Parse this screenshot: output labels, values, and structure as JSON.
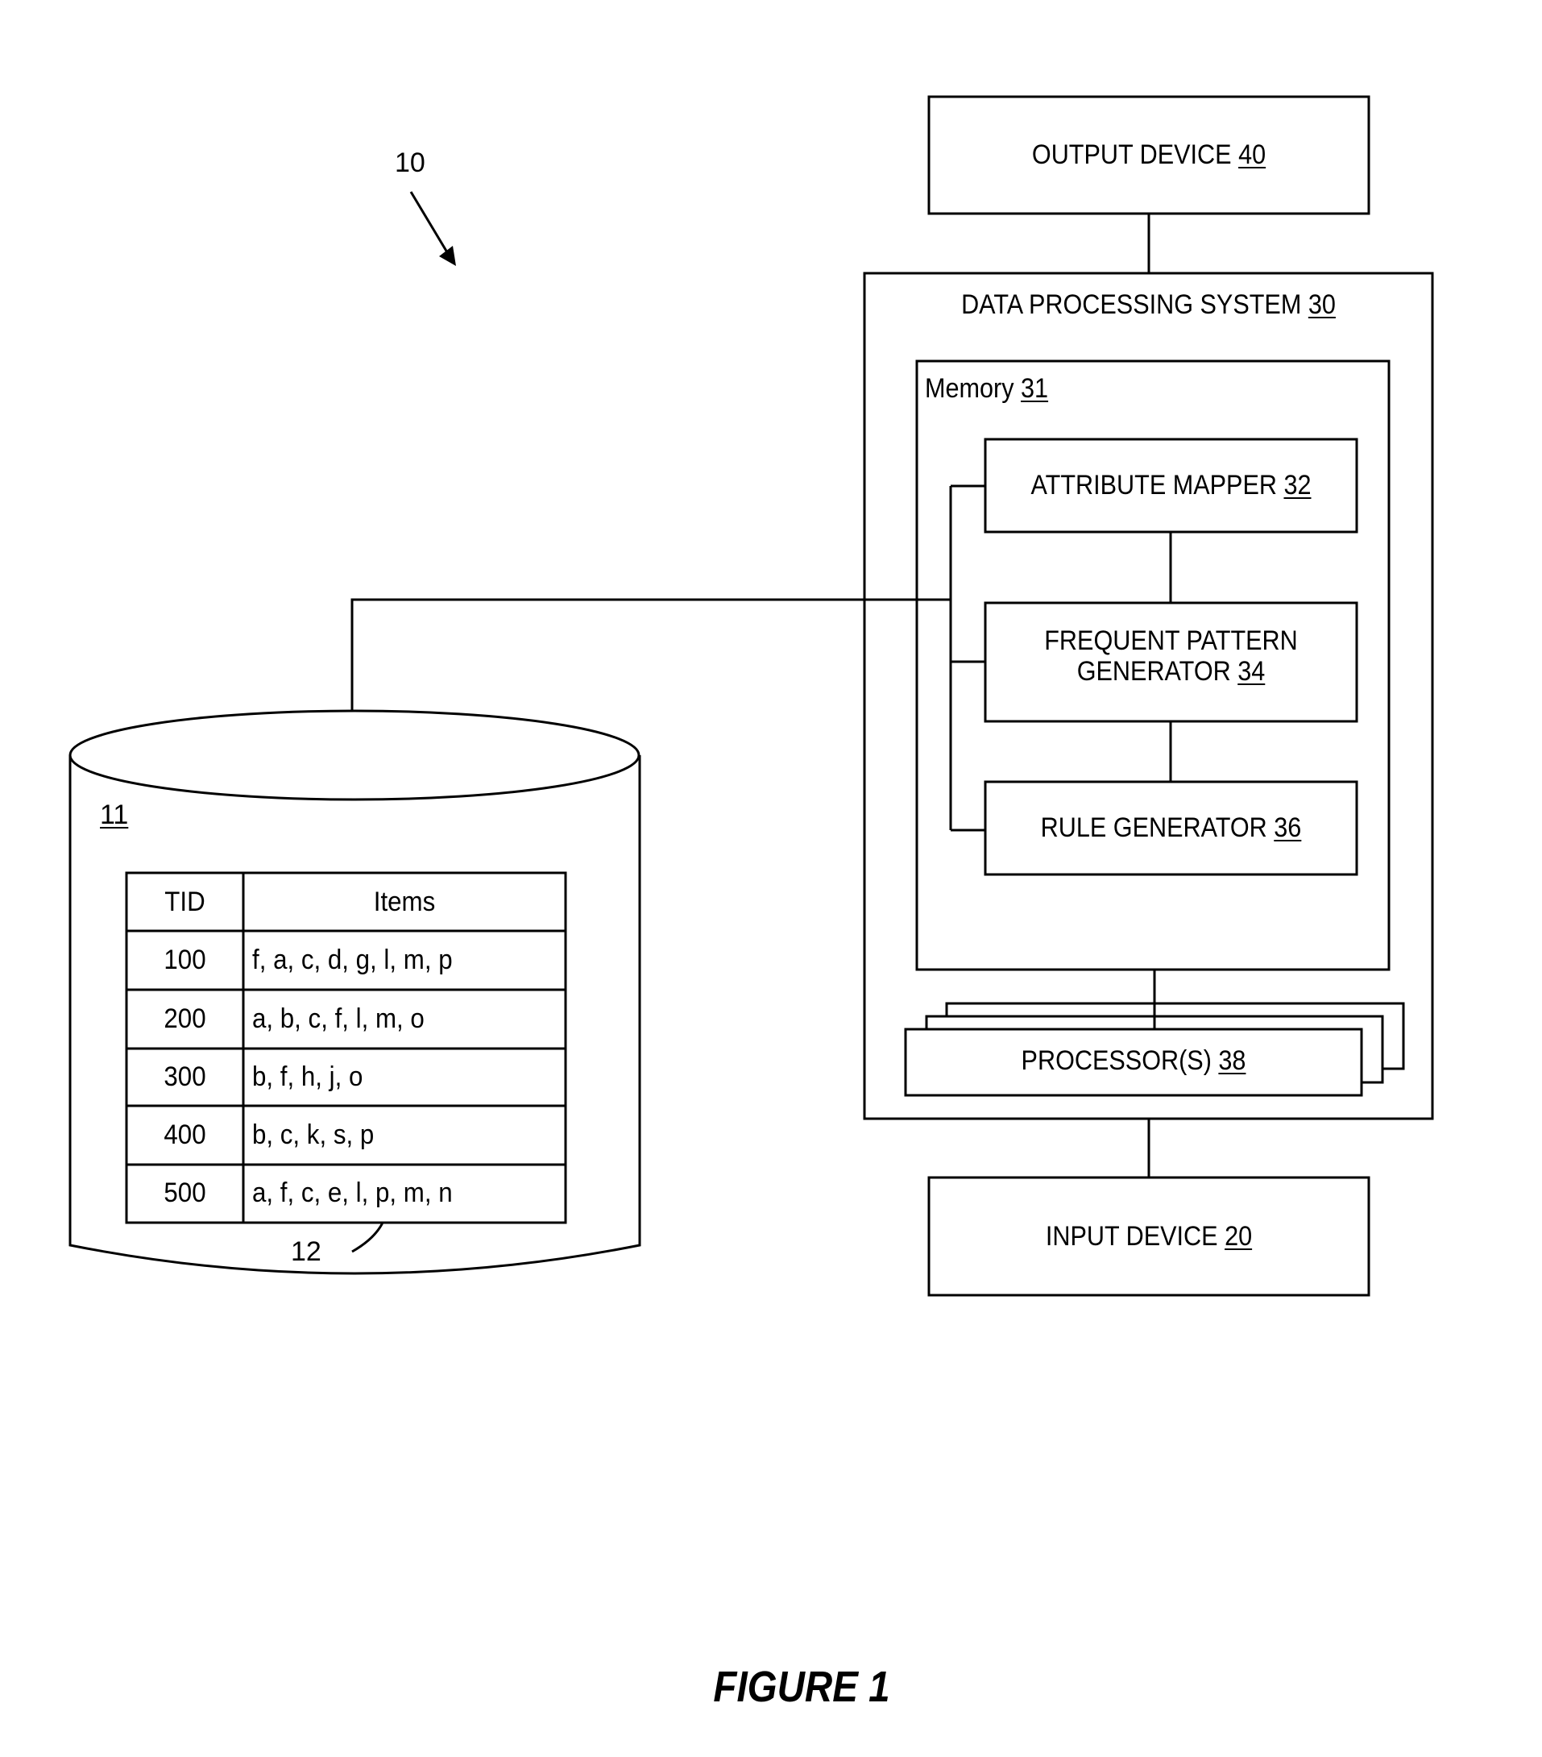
{
  "figure": {
    "ref_label": "10",
    "caption": "FIGURE 1"
  },
  "output_device": {
    "label": "OUTPUT DEVICE",
    "ref": "40"
  },
  "data_processing_system": {
    "label": "DATA PROCESSING SYSTEM",
    "ref": "30"
  },
  "memory": {
    "label": "Memory",
    "ref": "31"
  },
  "attribute_mapper": {
    "label": "ATTRIBUTE MAPPER",
    "ref": "32"
  },
  "frequent_pattern_generator": {
    "label_line1": "FREQUENT PATTERN",
    "label_line2": "GENERATOR",
    "ref": "34"
  },
  "rule_generator": {
    "label": "RULE GENERATOR",
    "ref": "36"
  },
  "processors": {
    "label": "PROCESSOR(S)",
    "ref": "38"
  },
  "input_device": {
    "label": "INPUT DEVICE",
    "ref": "20"
  },
  "database": {
    "ref": "11",
    "table_ref": "12",
    "table": {
      "headers": [
        "TID",
        "Items"
      ],
      "rows": [
        {
          "tid": "100",
          "items": "f, a, c, d, g, l, m, p"
        },
        {
          "tid": "200",
          "items": "a, b, c, f, l, m, o"
        },
        {
          "tid": "300",
          "items": "b, f, h, j, o"
        },
        {
          "tid": "400",
          "items": "b, c, k, s, p"
        },
        {
          "tid": "500",
          "items": "a, f, c, e, l, p, m, n"
        }
      ]
    }
  }
}
